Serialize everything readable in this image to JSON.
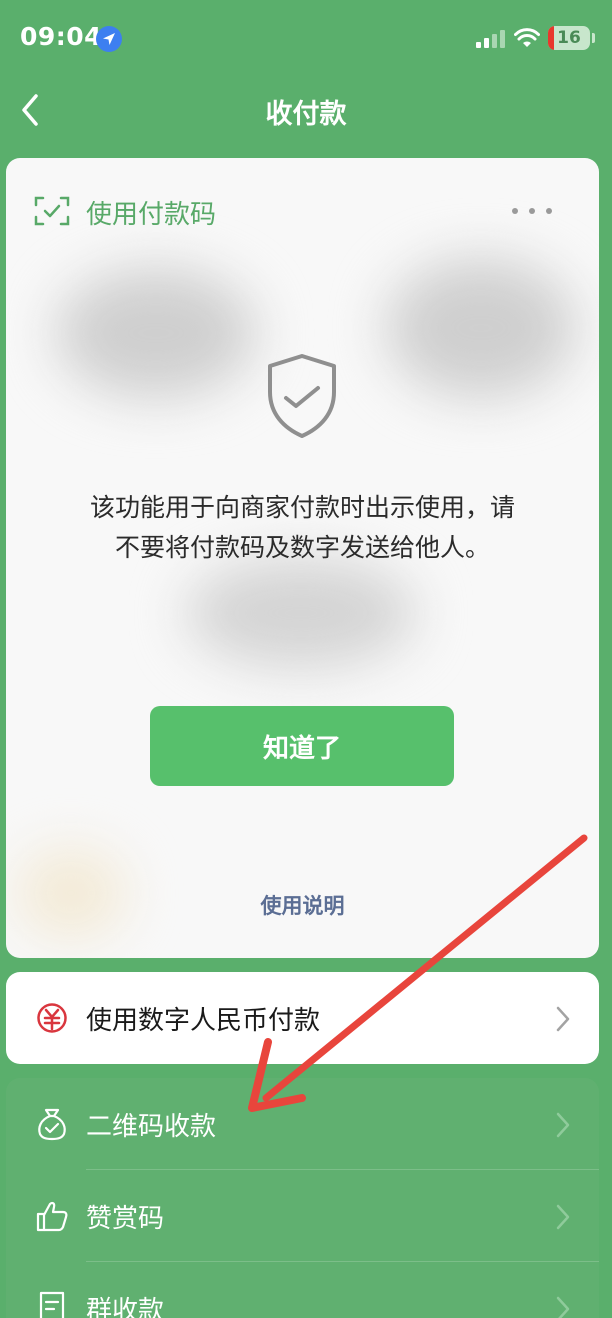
{
  "status_bar": {
    "time": "09:04",
    "battery_level": "16",
    "icons": [
      "location-arrow-icon",
      "cellular-signal-icon",
      "wifi-icon",
      "battery-icon"
    ]
  },
  "nav": {
    "title": "收付款",
    "back_icon": "chevron-left-icon"
  },
  "payment_card": {
    "title": "使用付款码",
    "title_icon": "scan-frame-check-icon",
    "more_icon": "more-dots-icon",
    "shield_icon": "shield-check-icon",
    "notice_line1": "该功能用于向商家付款时出示使用，请",
    "notice_line2": "不要将付款码及数字发送给他人。",
    "confirm_button": "知道了",
    "help_link": "使用说明"
  },
  "ecny_row": {
    "label": "使用数字人民币付款",
    "icon": "yuan-circle-icon"
  },
  "list": {
    "items": [
      {
        "label": "二维码收款",
        "icon": "money-bag-icon"
      },
      {
        "label": "赞赏码",
        "icon": "thumbs-up-icon"
      },
      {
        "label": "群收款",
        "icon": "receipt-icon"
      }
    ]
  },
  "colors": {
    "background_green": "#5aaf6c",
    "accent_green": "#57c06c",
    "title_green": "#58a968",
    "link_blue": "#5b6e94",
    "ecny_red": "#d9363e",
    "arrow_red": "#e8453c"
  }
}
